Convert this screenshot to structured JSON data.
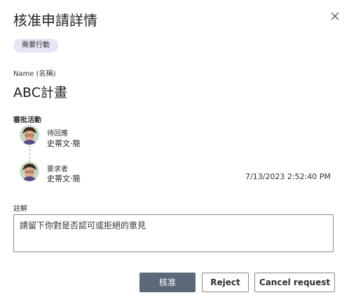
{
  "dialog": {
    "title": "核准申請詳情",
    "status_badge": "需要行動"
  },
  "name_field": {
    "label": "Name (名稱)",
    "value": "ABC計畫"
  },
  "approval_activity": {
    "label": "審批活動",
    "entries": [
      {
        "status": "待回應",
        "person": "史蒂文·簡",
        "timestamp": ""
      },
      {
        "status": "要求者",
        "person": "史蒂文·簡",
        "timestamp": "7/13/2023 2:52:40 PM"
      }
    ]
  },
  "comments": {
    "label": "註解",
    "placeholder": "請留下你對是否認可或拒絕的意見"
  },
  "actions": {
    "approve_label": "核准",
    "reject_label": "Reject",
    "cancel_label": "Cancel request"
  },
  "icons": {
    "close": "close-icon",
    "avatar": "avatar"
  },
  "colors": {
    "badge_bg": "#e8e4f4",
    "primary_button": "#5b6978"
  }
}
